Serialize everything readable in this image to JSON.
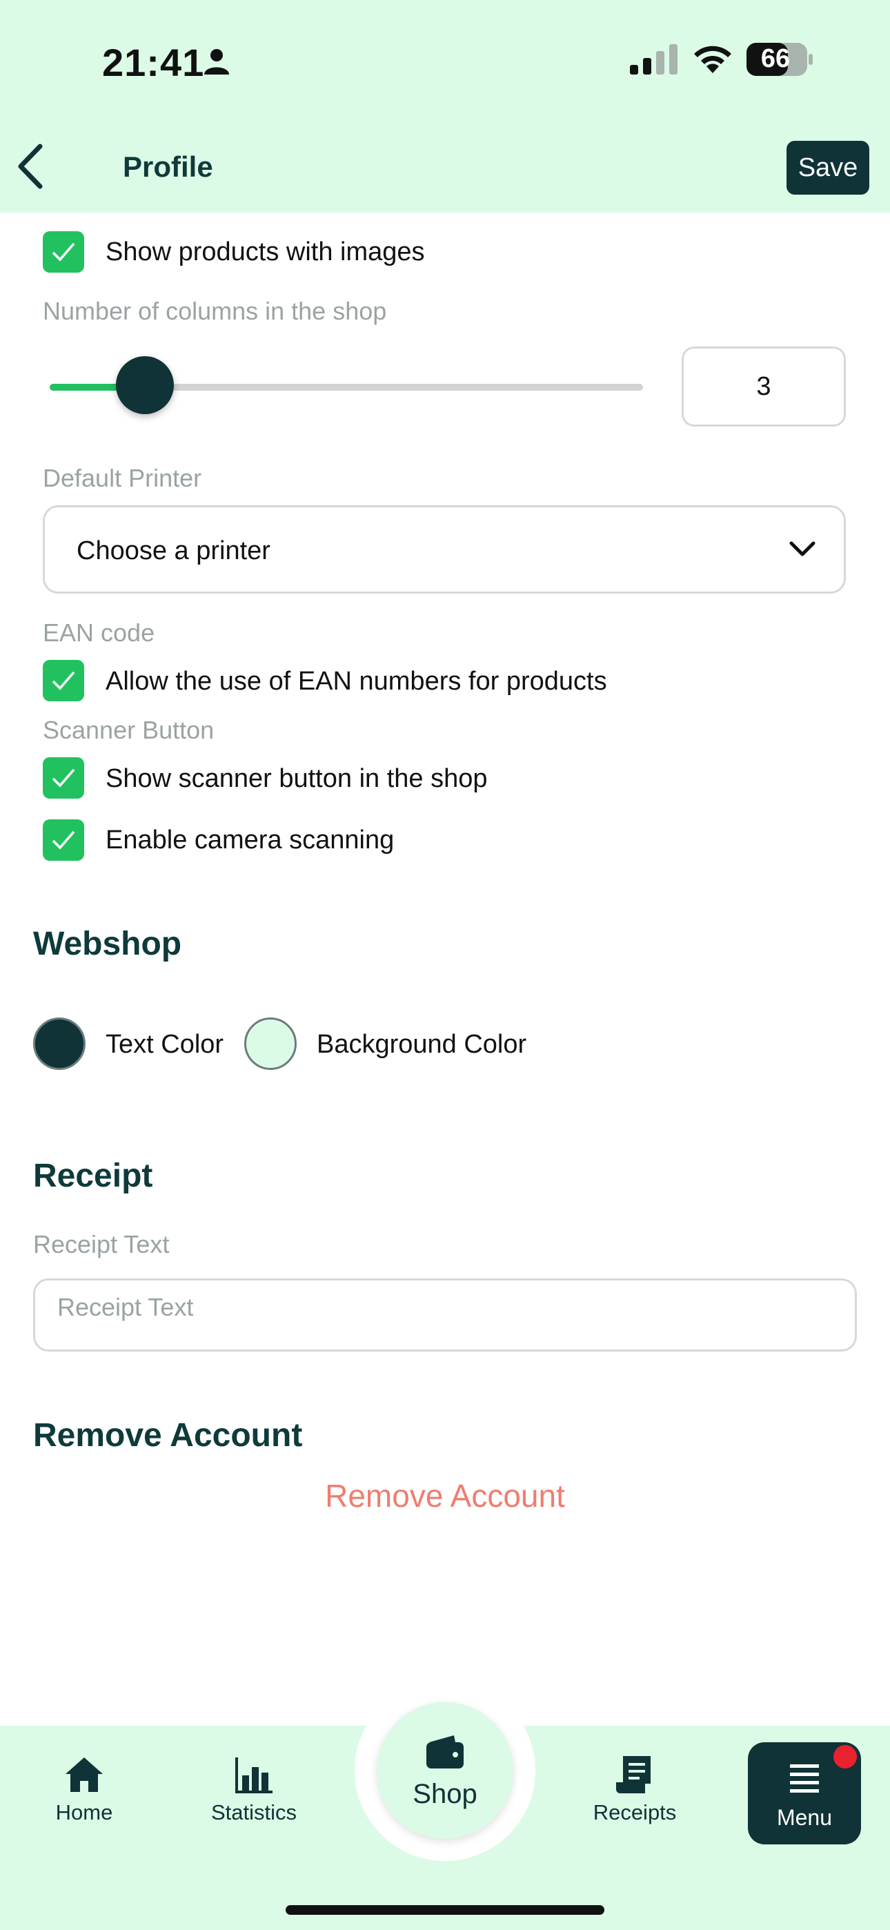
{
  "status_bar": {
    "time": "21:41",
    "battery": "66"
  },
  "header": {
    "title": "Profile",
    "save_label": "Save",
    "background": "#dcfbe6"
  },
  "shop_settings": {
    "show_images_label": "Show products with images",
    "show_images_checked": true,
    "columns_label": "Number of columns in the shop",
    "columns_value": "3",
    "columns_slider_fraction": 0.16,
    "printer_label": "Default Printer",
    "printer_placeholder": "Choose a printer",
    "ean_section": "EAN code",
    "ean_label": "Allow the use of EAN numbers for products",
    "ean_checked": true,
    "scanner_section": "Scanner Button",
    "scanner_label": "Show scanner button in the shop",
    "scanner_checked": true,
    "camera_label": "Enable camera scanning",
    "camera_checked": true
  },
  "webshop": {
    "heading": "Webshop",
    "text_color_label": "Text Color",
    "text_color": "#0f3336",
    "bg_color_label": "Background Color",
    "bg_color": "#dcfbe6"
  },
  "receipt": {
    "heading": "Receipt",
    "field_label": "Receipt Text",
    "field_placeholder": "Receipt Text"
  },
  "remove_account": {
    "heading": "Remove Account",
    "link_label": "Remove Account",
    "link_color": "#ef7d6f"
  },
  "bottom_nav": {
    "home": "Home",
    "statistics": "Statistics",
    "shop": "Shop",
    "receipts": "Receipts",
    "menu": "Menu"
  },
  "colors": {
    "accent_green": "#22c160",
    "dark_teal": "#0f3336",
    "notification_dot": "#e8222e"
  }
}
